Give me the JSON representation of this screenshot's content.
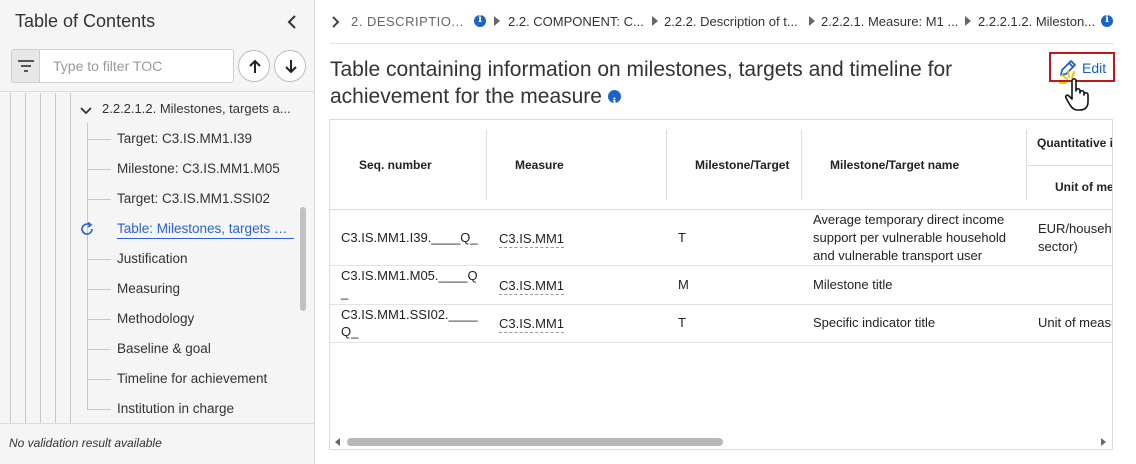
{
  "toc": {
    "title": "Table of Contents",
    "filter_placeholder": "Type to filter TOC",
    "node_label": "2.2.2.1.2. Milestones, targets a...",
    "items": [
      {
        "label": "Target: C3.IS.MM1.I39"
      },
      {
        "label": "Milestone: C3.IS.MM1.M05"
      },
      {
        "label": "Target: C3.IS.MM1.SSI02"
      },
      {
        "label": "Table: Milestones, targets & ..."
      },
      {
        "label": "Justification"
      },
      {
        "label": "Measuring"
      },
      {
        "label": "Methodology"
      },
      {
        "label": "Baseline & goal"
      },
      {
        "label": "Timeline for achievement"
      },
      {
        "label": "Institution in charge"
      }
    ],
    "footer": "No validation result available"
  },
  "breadcrumb": [
    {
      "label": "2. DESCRIPTIO..."
    },
    {
      "label": "2.2. COMPONENT: C..."
    },
    {
      "label": "2.2.2. Description of t..."
    },
    {
      "label": "2.2.2.1. Measure: M1 ..."
    },
    {
      "label": "2.2.2.1.2. Mileston..."
    }
  ],
  "page": {
    "title": "Table containing information on milestones, targets and timeline for achievement for the measure",
    "edit_label": "Edit"
  },
  "table": {
    "headers": {
      "seq": "Seq. number",
      "measure": "Measure",
      "mt": "Milestone/Target",
      "name": "Milestone/Target name",
      "quant": "Quantitative i",
      "unit": "Unit of me"
    },
    "rows": [
      {
        "seq_a": "C3.IS.MM1.I39.____Q_",
        "seq_b": "",
        "measure": "C3.IS.MM1",
        "mt": "T",
        "name": "Average temporary direct income support per vulnerable household and vulnerable transport user",
        "unit_a": "EUR/househo",
        "unit_b": "sector)"
      },
      {
        "seq_a": "C3.IS.MM1.M05.____Q",
        "seq_b": "_",
        "measure": "C3.IS.MM1",
        "mt": "M",
        "name": "Milestone title",
        "unit_a": "",
        "unit_b": ""
      },
      {
        "seq_a": "C3.IS.MM1.SSI02.____",
        "seq_b": "Q_",
        "measure": "C3.IS.MM1",
        "mt": "T",
        "name": "Specific indicator title",
        "unit_a": "Unit of measu",
        "unit_b": ""
      }
    ]
  },
  "colors": {
    "accent": "#2a62d6",
    "info": "#1a64c9",
    "highlight_border": "#b71c1c"
  }
}
